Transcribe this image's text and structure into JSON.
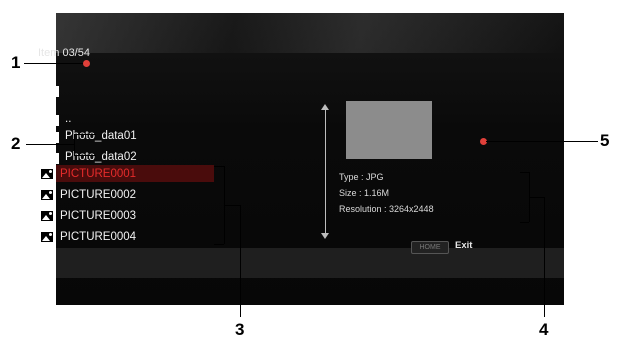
{
  "header": {
    "item_count": "Item 03/54"
  },
  "list": {
    "items": [
      {
        "type": "folder",
        "label": ""
      },
      {
        "type": "parent",
        "label": ".."
      },
      {
        "type": "folder",
        "label": "Photo_data01"
      },
      {
        "type": "folder",
        "label": "Photo_data02"
      },
      {
        "type": "picture",
        "label": "PICTURE0001",
        "selected": true
      },
      {
        "type": "picture",
        "label": "PICTURE0002"
      },
      {
        "type": "picture",
        "label": "PICTURE0003"
      },
      {
        "type": "picture",
        "label": "PICTURE0004"
      }
    ]
  },
  "preview": {
    "type": "Type : JPG",
    "size": "Size : 1.16M",
    "resolution": "Resolution : 3264x2448"
  },
  "footer": {
    "home_label": "HOME",
    "exit_label": "Exit"
  },
  "callouts": {
    "c1": "1",
    "c2": "2",
    "c3": "3",
    "c4": "4",
    "c5": "5"
  },
  "colors": {
    "selected_text": "#e52b2b",
    "callout_dot": "#e0403a",
    "screen_bg": "#0a0a0a"
  }
}
